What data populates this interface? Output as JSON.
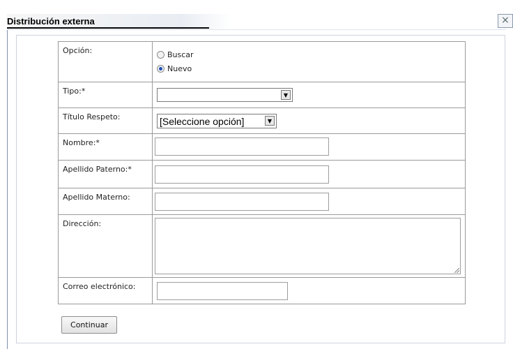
{
  "dialog": {
    "title": "Distribución externa",
    "close_glyph": "×"
  },
  "form": {
    "option": {
      "label": "Opción:",
      "choices": [
        {
          "label": "Buscar",
          "selected": false
        },
        {
          "label": "Nuevo",
          "selected": true
        }
      ]
    },
    "tipo": {
      "label": "Tipo:*",
      "value": ""
    },
    "titulo_respeto": {
      "label": "Título Respeto:",
      "value": "[Seleccione opción]"
    },
    "nombre": {
      "label": "Nombre:*",
      "value": ""
    },
    "apellido_paterno": {
      "label": "Apellido Paterno:*",
      "value": ""
    },
    "apellido_materno": {
      "label": "Apellido Materno:",
      "value": ""
    },
    "direccion": {
      "label": "Dirección:",
      "value": ""
    },
    "correo": {
      "label": "Correo electrónico:",
      "value": ""
    }
  },
  "actions": {
    "continue_label": "Continuar"
  },
  "icons": {
    "close": "close-icon",
    "dropdown": "chevron-down-icon"
  }
}
